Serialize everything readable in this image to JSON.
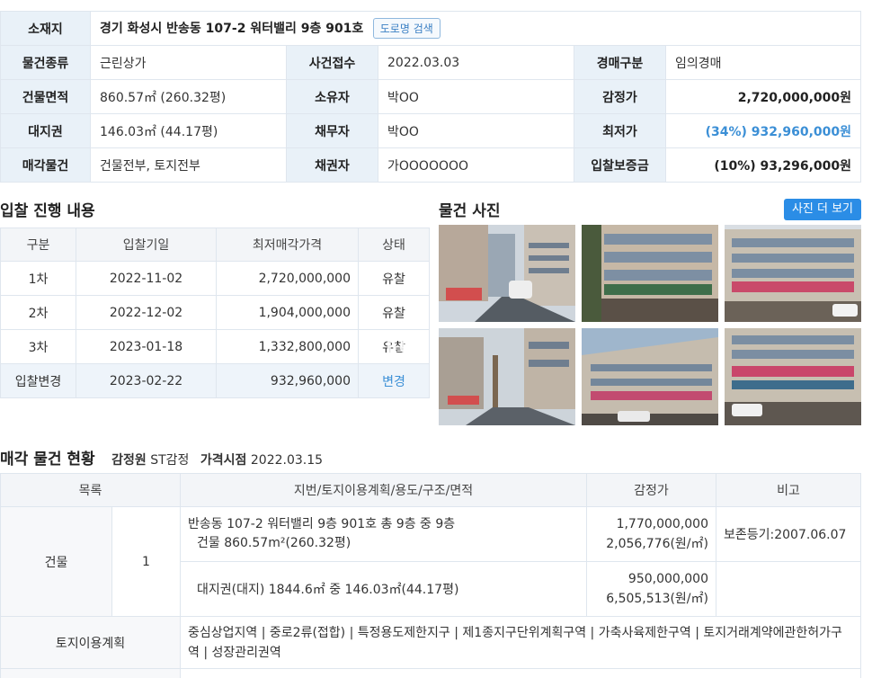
{
  "info": {
    "location_label": "소재지",
    "location_value": "경기 화성시 반송동 107-2 워터밸리 9층 901호",
    "road_search_btn": "도로명 검색",
    "rows": [
      [
        {
          "h": "물건종류"
        },
        {
          "v": "근린상가"
        },
        {
          "h": "사건접수"
        },
        {
          "v": "2022.03.03"
        },
        {
          "h": "경매구분"
        },
        {
          "v": "임의경매"
        }
      ],
      [
        {
          "h": "건물면적"
        },
        {
          "v": "860.57㎡ (260.32평)"
        },
        {
          "h": "소유자"
        },
        {
          "v": "박OO"
        },
        {
          "h": "감정가"
        },
        {
          "v": "2,720,000,000원"
        }
      ],
      [
        {
          "h": "대지권"
        },
        {
          "v": "146.03㎡ (44.17평)"
        },
        {
          "h": "채무자"
        },
        {
          "v": "박OO"
        },
        {
          "h": "최저가"
        },
        {
          "v": "(34%) 932,960,000원"
        }
      ],
      [
        {
          "h": "매각물건"
        },
        {
          "v": "건물전부, 토지전부"
        },
        {
          "h": "채권자"
        },
        {
          "v": "가OOOOOOO"
        },
        {
          "h": "입찰보증금"
        },
        {
          "v": "(10%) 93,296,000원"
        }
      ]
    ]
  },
  "bid_section": {
    "title": "입찰 진행 내용",
    "headers": [
      "구분",
      "입찰기일",
      "최저매각가격",
      "상태"
    ],
    "rows": [
      [
        "1차",
        "2022-11-02",
        "2,720,000,000",
        "유찰"
      ],
      [
        "2차",
        "2022-12-02",
        "1,904,000,000",
        "유찰"
      ],
      [
        "3차",
        "2023-01-18",
        "1,332,800,000",
        "유찰"
      ],
      [
        "입찰변경",
        "2023-02-22",
        "932,960,000",
        "변경"
      ]
    ]
  },
  "photo_section": {
    "title": "물건 사진",
    "more_btn": "사진 더 보기",
    "watermark": "EREC"
  },
  "status_section": {
    "title": "매각 물건 현황",
    "appraiser_label": "감정원",
    "appraiser_value": "ST감정",
    "price_date_label": "가격시점",
    "price_date_value": "2022.03.15",
    "headers": [
      "목록",
      "지번/토지이용계획/용도/구조/면적",
      "감정가",
      "비고"
    ],
    "building_label": "건물",
    "building_no": "1",
    "row1_desc_line1": "반송동 107-2 워터밸리 9층 901호 총 9층 중 9층",
    "row1_desc_line2": "건물 860.57m²(260.32평)",
    "row1_price1": "1,770,000,000",
    "row1_price2": "2,056,776(원/㎡)",
    "row1_note": "보존등기:2007.06.07",
    "row2_desc": "대지권(대지) 1844.6㎡ 중 146.03㎡(44.17평)",
    "row2_price1": "950,000,000",
    "row2_price2": "6,505,513(원/㎡)",
    "land_label": "토지이용계획",
    "land_desc": "중심상업지역 | 중로2류(접합) | 특정용도제한지구 | 제1종지구단위계획구역 | 가축사육제한구역 | 토지거래계약에관한허가구역 | 성장관리권역"
  }
}
